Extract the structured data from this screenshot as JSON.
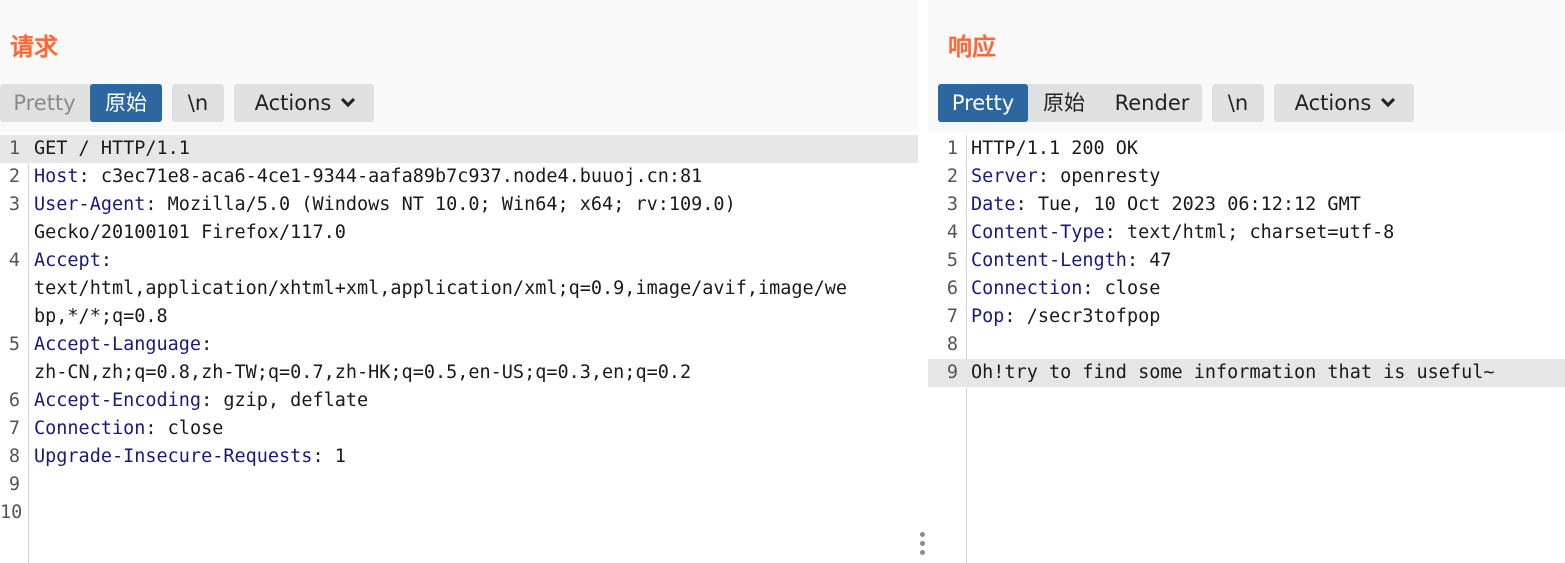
{
  "request": {
    "title": "请求",
    "tabs": {
      "pretty": "Pretty",
      "raw": "原始",
      "newline": "\\n",
      "actions": "Actions"
    },
    "lines": [
      {
        "num": "1",
        "name": "",
        "sep": "",
        "value": "GET / HTTP/1.1"
      },
      {
        "num": "2",
        "name": "Host",
        "sep": ": ",
        "value": "c3ec71e8-aca6-4ce1-9344-aafa89b7c937.node4.buuoj.cn:81"
      },
      {
        "num": "3",
        "name": "User-Agent",
        "sep": ": ",
        "value": "Mozilla/5.0 (Windows NT 10.0; Win64; x64; rv:109.0)"
      },
      {
        "num": "",
        "name": "",
        "sep": "",
        "value": "Gecko/20100101 Firefox/117.0"
      },
      {
        "num": "4",
        "name": "Accept",
        "sep": ":",
        "value": ""
      },
      {
        "num": "",
        "name": "",
        "sep": "",
        "value": "text/html,application/xhtml+xml,application/xml;q=0.9,image/avif,image/we"
      },
      {
        "num": "",
        "name": "",
        "sep": "",
        "value": "bp,*/*;q=0.8"
      },
      {
        "num": "5",
        "name": "Accept-Language",
        "sep": ":",
        "value": ""
      },
      {
        "num": "",
        "name": "",
        "sep": "",
        "value": "zh-CN,zh;q=0.8,zh-TW;q=0.7,zh-HK;q=0.5,en-US;q=0.3,en;q=0.2"
      },
      {
        "num": "6",
        "name": "Accept-Encoding",
        "sep": ": ",
        "value": "gzip, deflate"
      },
      {
        "num": "7",
        "name": "Connection",
        "sep": ": ",
        "value": "close"
      },
      {
        "num": "8",
        "name": "Upgrade-Insecure-Requests",
        "sep": ": ",
        "value": "1"
      },
      {
        "num": "9",
        "name": "",
        "sep": "",
        "value": ""
      },
      {
        "num": "10",
        "name": "",
        "sep": "",
        "value": ""
      }
    ]
  },
  "response": {
    "title": "响应",
    "tabs": {
      "pretty": "Pretty",
      "raw": "原始",
      "render": "Render",
      "newline": "\\n",
      "actions": "Actions"
    },
    "lines": [
      {
        "num": "1",
        "name": "",
        "sep": "",
        "value": "HTTP/1.1 200 OK"
      },
      {
        "num": "2",
        "name": "Server",
        "sep": ": ",
        "value": "openresty"
      },
      {
        "num": "3",
        "name": "Date",
        "sep": ": ",
        "value": "Tue, 10 Oct 2023 06:12:12 GMT"
      },
      {
        "num": "4",
        "name": "Content-Type",
        "sep": ": ",
        "value": "text/html; charset=utf-8"
      },
      {
        "num": "5",
        "name": "Content-Length",
        "sep": ": ",
        "value": "47"
      },
      {
        "num": "6",
        "name": "Connection",
        "sep": ": ",
        "value": "close"
      },
      {
        "num": "7",
        "name": "Pop",
        "sep": ": ",
        "value": "/secr3tofpop"
      },
      {
        "num": "8",
        "name": "",
        "sep": "",
        "value": ""
      },
      {
        "num": "9",
        "name": "",
        "sep": "",
        "value": "Oh!try to find some information that is useful~"
      }
    ]
  },
  "colors": {
    "title": "#ff6633",
    "active_tab": "#2d67a0",
    "header_name": "#1a1a7a",
    "highlight": "#e6e6e6"
  }
}
